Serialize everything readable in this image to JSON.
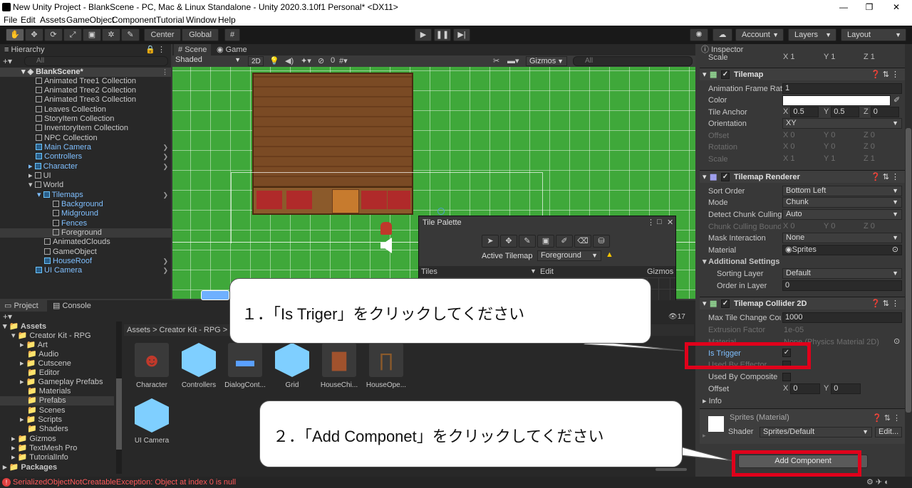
{
  "window": {
    "title": "New Unity Project - BlankScene - PC, Mac & Linux Standalone - Unity 2020.3.10f1 Personal* <DX11>"
  },
  "menu": [
    "File",
    "Edit",
    "Assets",
    "GameObject",
    "Component",
    "Tutorial",
    "Window",
    "Help"
  ],
  "toolbar": {
    "center": "Center",
    "global": "Global",
    "account": "Account",
    "layers": "Layers",
    "layout": "Layout"
  },
  "hierarchy": {
    "tab": "Hierarchy",
    "search_placeholder": "All",
    "scene": "BlankScene*",
    "items": [
      "Animated Tree1 Collection",
      "Animated Tree2 Collection",
      "Animated Tree3 Collection",
      "Leaves Collection",
      "StoryItem Collection",
      "InventoryItem Collection",
      "NPC Collection",
      "Main Camera",
      "Controllers",
      "Character",
      "UI",
      "World",
      "Tilemaps",
      "Background",
      "Midground",
      "Fences",
      "Foreground",
      "AnimatedClouds",
      "GameObject",
      "HouseRoof",
      "UI Camera"
    ]
  },
  "scene_view": {
    "tab_scene": "Scene",
    "tab_game": "Game",
    "shading": "Shaded",
    "mode2d": "2D",
    "gizmos": "Gizmos",
    "search_placeholder": "All",
    "layer_count": "0"
  },
  "tile_palette": {
    "title": "Tile Palette",
    "active_label": "Active Tilemap",
    "active_value": "Foreground",
    "tiles": "Tiles",
    "edit": "Edit",
    "gizmos": "Gizmos"
  },
  "project": {
    "tab_project": "Project",
    "tab_console": "Console",
    "breadcrumb": "Assets > Creator Kit - RPG >",
    "count": "17",
    "tree": [
      "Assets",
      "Creator Kit - RPG",
      "Art",
      "Audio",
      "Cutscene",
      "Editor",
      "Gameplay Prefabs",
      "Materials",
      "Prefabs",
      "Scenes",
      "Scripts",
      "Shaders",
      "Gizmos",
      "TextMesh Pro",
      "TutorialInfo",
      "Packages"
    ],
    "assets": [
      "Character",
      "Controllers",
      "DialogCont...",
      "Grid",
      "HouseChi...",
      "HouseOpe...",
      "UI Camera"
    ]
  },
  "inspector": {
    "tab": "Inspector",
    "scale_label": "Scale",
    "scale": {
      "x": "1",
      "y": "1",
      "z": "1"
    },
    "tilemap": {
      "title": "Tilemap",
      "anim_label": "Animation Frame Rate",
      "anim_value": "1",
      "color_label": "Color",
      "anchor_label": "Tile Anchor",
      "anchor": {
        "x": "0.5",
        "y": "0.5",
        "z": "0"
      },
      "orientation_label": "Orientation",
      "orientation": "XY",
      "offset_label": "Offset",
      "offset": {
        "x": "0",
        "y": "0",
        "z": "0"
      },
      "rotation_label": "Rotation",
      "rotation": {
        "x": "0",
        "y": "0",
        "z": "0"
      },
      "scale_label": "Scale",
      "scale": {
        "x": "1",
        "y": "1",
        "z": "1"
      }
    },
    "renderer": {
      "title": "Tilemap Renderer",
      "sort_label": "Sort Order",
      "sort": "Bottom Left",
      "mode_label": "Mode",
      "mode": "Chunk",
      "detect_label": "Detect Chunk Culling",
      "detect": "Auto",
      "bounds_label": "Chunk Culling Bounds",
      "bounds": {
        "x": "0",
        "y": "0",
        "z": "0"
      },
      "mask_label": "Mask Interaction",
      "mask": "None",
      "material_label": "Material",
      "material": "Sprites",
      "additional": "Additional Settings",
      "sorting_layer_label": "Sorting Layer",
      "sorting_layer": "Default",
      "order_label": "Order in Layer",
      "order": "0"
    },
    "collider": {
      "title": "Tilemap Collider 2D",
      "max_label": "Max Tile Change Count",
      "max": "1000",
      "extrusion_label": "Extrusion Factor",
      "extrusion": "1e-05",
      "material_label": "Material",
      "material": "None (Physics Material 2D)",
      "trigger_label": "Is Trigger",
      "effector_label": "Used By Effector",
      "composite_label": "Used By Composite",
      "offset_label": "Offset",
      "offset": {
        "x": "0",
        "y": "0"
      },
      "info": "Info"
    },
    "mat": {
      "name": "Sprites (Material)",
      "shader_label": "Shader",
      "shader": "Sprites/Default",
      "edit": "Edit..."
    },
    "add_component": "Add Component"
  },
  "callouts": {
    "one": "１．「Is Triger」をクリックしてください",
    "two": "２．「Add Componet」をクリックしてください"
  },
  "status": {
    "error": "SerializedObjectNotCreatableException: Object at index 0 is null"
  },
  "colors": {
    "accent_red": "#e0001b",
    "link_blue": "#7fbfff",
    "grass": "#3fa83a"
  }
}
